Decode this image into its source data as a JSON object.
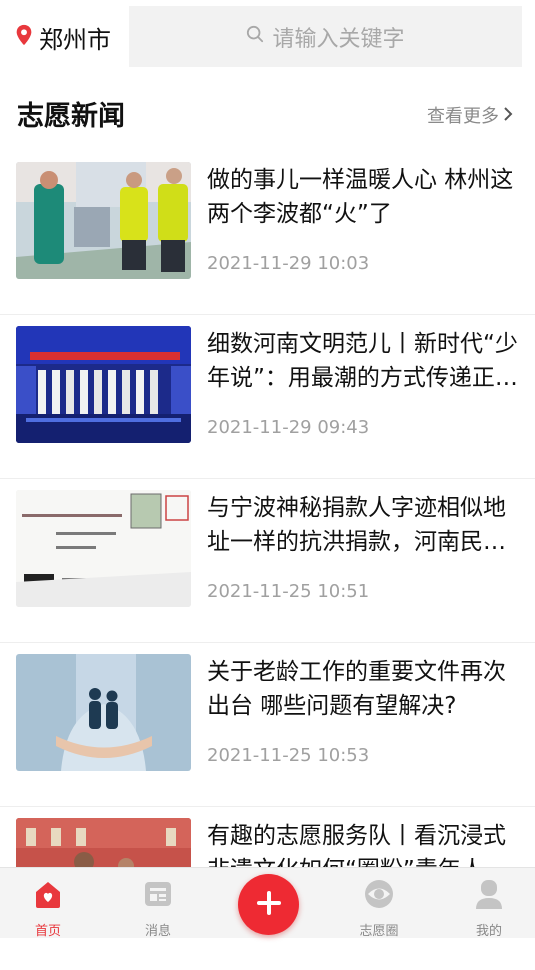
{
  "header": {
    "location_icon": "location-pin-icon",
    "city": "郑州市",
    "search_placeholder": "请输入关键字",
    "search_icon": "search-icon"
  },
  "section": {
    "title": "志愿新闻",
    "more_label": "查看更多"
  },
  "news": [
    {
      "title": "做的事儿一样温暖人心 林州这两个李波都“火”了",
      "time": "2021-11-29 10:03"
    },
    {
      "title": "细数河南文明范儿丨新时代“少年说”：用最潮的方式传递正能量",
      "time": "2021-11-29 09:43"
    },
    {
      "title": "与宁波神秘捐款人字迹相似地址一样的抗洪捐款，河南民政厅收到了",
      "time": "2021-11-25 10:51"
    },
    {
      "title": "关于老龄工作的重要文件再次出台 哪些问题有望解决?",
      "time": "2021-11-25 10:53"
    },
    {
      "title": "有趣的志愿服务队丨看沉浸式非遗文化如何“圈粉”青年人",
      "time": ""
    }
  ],
  "tabbar": {
    "tabs": [
      {
        "label": "首页",
        "icon": "home-icon",
        "active": true
      },
      {
        "label": "消息",
        "icon": "message-icon",
        "active": false
      },
      {
        "label": "志愿圈",
        "icon": "eye-icon",
        "active": false
      },
      {
        "label": "我的",
        "icon": "user-icon",
        "active": false
      }
    ],
    "fab_icon": "plus-icon"
  },
  "colors": {
    "accent": "#ee2a33",
    "text": "#111111",
    "muted": "#a0a0a0"
  }
}
